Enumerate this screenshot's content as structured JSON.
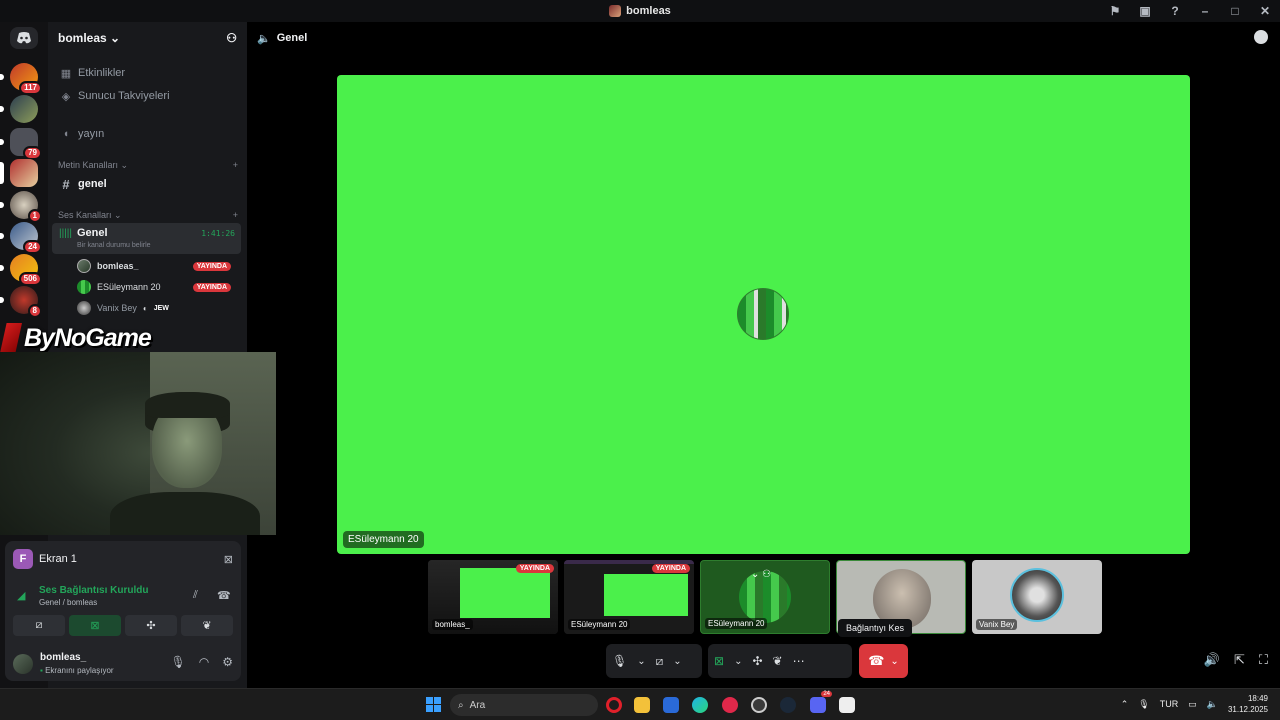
{
  "window": {
    "title": "bomleas"
  },
  "guilds": [
    {
      "badge": "117"
    },
    {
      "badge": ""
    },
    {
      "badge": "79"
    },
    {
      "badge": ""
    },
    {
      "badge": "1"
    },
    {
      "badge": "24"
    },
    {
      "badge": "506"
    },
    {
      "badge": "8"
    }
  ],
  "server": {
    "name": "bomleas",
    "events": "Etkinlikler",
    "boosts": "Sunucu Takviyeleri",
    "stage_channel": "yayın",
    "text_category": "Metin Kanalları",
    "text_channel": "genel",
    "voice_category": "Ses Kanalları",
    "voice_channel": "Genel",
    "voice_status": "Bir kanal durumu belirle",
    "voice_time": "1:41:26",
    "members": [
      {
        "name": "bomleas_",
        "live": "YAYINDA"
      },
      {
        "name": "ESüleymann 20",
        "live": "YAYINDA"
      },
      {
        "name": "Vanix Bey",
        "tag": "JEW"
      }
    ]
  },
  "overlay": {
    "logo_text": "ByNoGame"
  },
  "voice_panel": {
    "screen_initial": "F",
    "screen_name": "Ekran 1",
    "connection": "Ses Bağlantısı Kuruldu",
    "connection_sub": "Genel / bomleas",
    "user_name": "bomleas_",
    "user_status": "Ekranını paylaşıyor"
  },
  "main": {
    "channel_title": "Genel",
    "stream_owner": "ESüleymann 20",
    "thumbnails": [
      {
        "label": "bomleas_",
        "badge": "YAYINDA"
      },
      {
        "label": "ESüleymann 20",
        "badge": "YAYINDA"
      },
      {
        "label": "ESüleymann 20",
        "badge": ""
      },
      {
        "label": "",
        "badge": ""
      },
      {
        "label": "Vanix Bey",
        "badge": ""
      }
    ],
    "tooltip": "Bağlantıyı Kes"
  },
  "taskbar": {
    "search_placeholder": "Ara",
    "language": "TUR",
    "time": "18:49",
    "date": "31.12.2025",
    "discord_badge": "24"
  }
}
